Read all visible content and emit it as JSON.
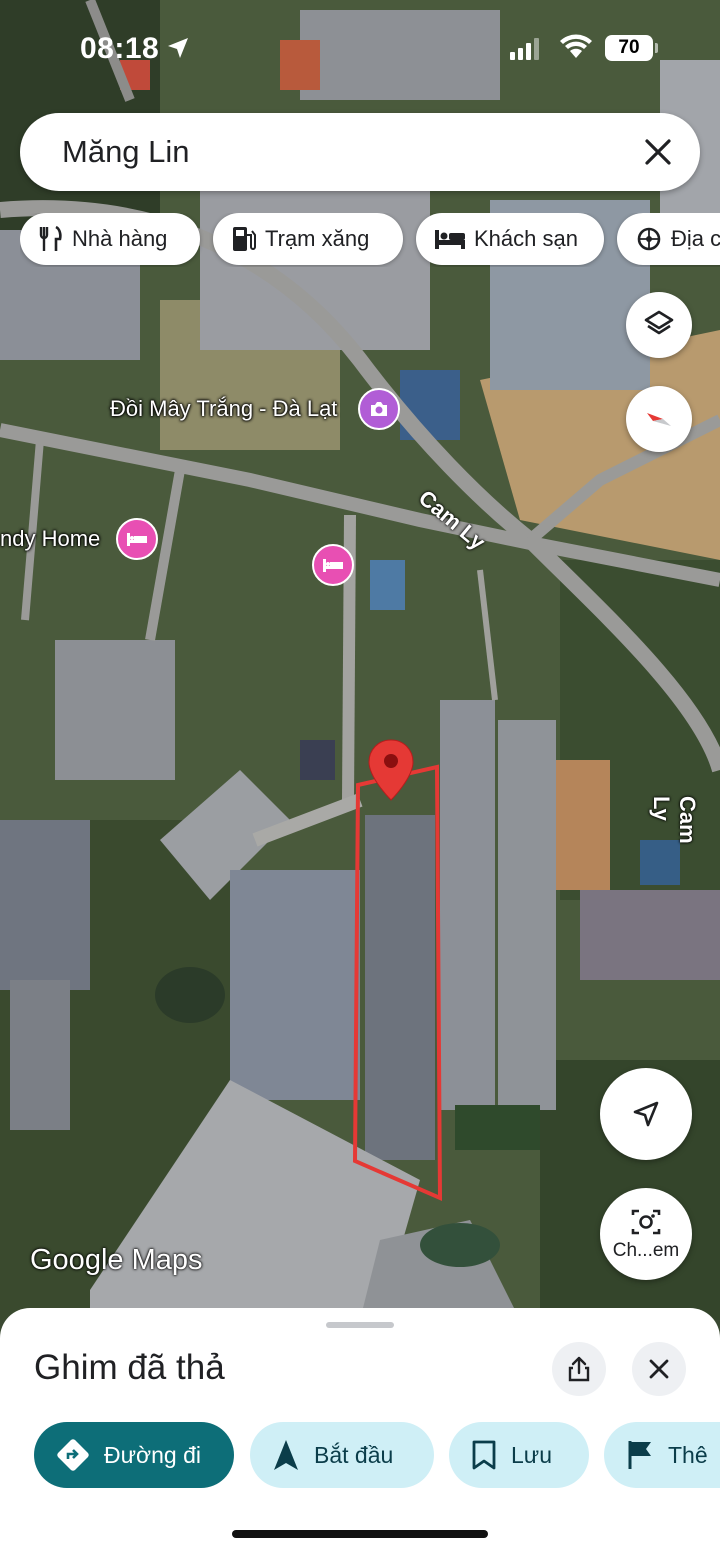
{
  "status_bar": {
    "time": "08:18",
    "battery": "70"
  },
  "search": {
    "query": "Măng Lin"
  },
  "chips": [
    {
      "label": "Nhà hàng",
      "icon": "fork-knife-icon"
    },
    {
      "label": "Trạm xăng",
      "icon": "gas-station-icon"
    },
    {
      "label": "Khách sạn",
      "icon": "bed-icon"
    },
    {
      "label": "Địa c",
      "icon": "attraction-icon"
    }
  ],
  "map": {
    "labels": {
      "doi_may_trang": "Đồi Mây Trắng - Đà Lạt",
      "cam_ly_1": "Cam Ly",
      "cam_ly_2": "Cam Ly",
      "ndy_home": "ndy Home"
    },
    "watermark": "Google Maps",
    "lens_label": "Ch...em",
    "boundary_color": "#e53935",
    "pin_color": "#e53935"
  },
  "sheet": {
    "title": "Ghim đã thả",
    "actions": [
      {
        "label": "Đường đi",
        "icon": "directions-icon"
      },
      {
        "label": "Bắt đầu",
        "icon": "navigation-arrow-icon"
      },
      {
        "label": "Lưu",
        "icon": "bookmark-icon"
      },
      {
        "label": "Thê",
        "icon": "flag-icon"
      }
    ]
  }
}
